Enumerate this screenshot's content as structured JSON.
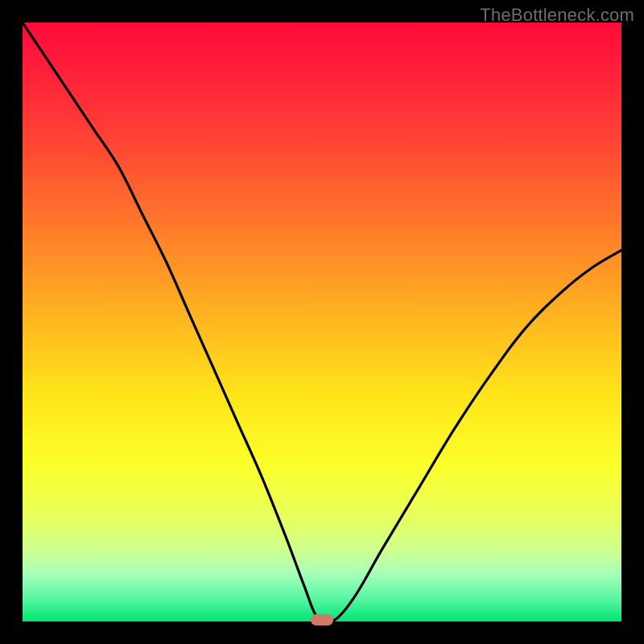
{
  "watermark": {
    "text": "TheBottleneck.com"
  },
  "colors": {
    "bg_black": "#000000",
    "curve": "#000000",
    "marker": "#cf7a68",
    "gradient_top": "#ff0a3a",
    "gradient_bottom": "#00e472"
  },
  "chart_data": {
    "type": "line",
    "title": "",
    "xlabel": "",
    "ylabel": "",
    "xlim": [
      0,
      100
    ],
    "ylim": [
      0,
      100
    ],
    "grid": false,
    "legend": false,
    "note": "V-shaped bottleneck curve; values are read off the shape (no numeric ticks shown). y ≈ 0 at x ≈ 49–52 where the pill marker sits.",
    "series": [
      {
        "name": "bottleneck-curve",
        "x": [
          0,
          4,
          8,
          12,
          16,
          20,
          24,
          28,
          32,
          36,
          40,
          44,
          47,
          49,
          51,
          53,
          56,
          60,
          66,
          72,
          78,
          84,
          90,
          95,
          100
        ],
        "y": [
          100,
          94,
          88,
          82,
          76,
          68,
          60,
          51,
          42,
          33,
          24,
          14,
          6,
          1,
          0,
          1,
          5,
          12,
          22,
          32,
          41,
          49,
          55,
          59,
          62
        ]
      }
    ],
    "marker": {
      "x": 50,
      "y": 0,
      "shape": "pill"
    }
  }
}
